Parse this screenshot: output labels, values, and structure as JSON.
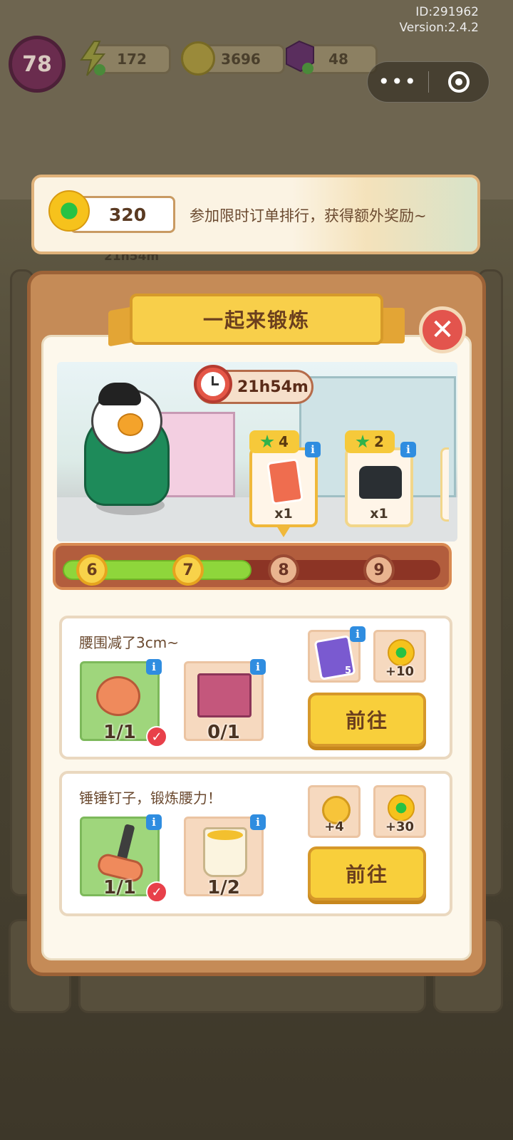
{
  "system": {
    "id": "ID:291962",
    "version": "Version:2.4.2"
  },
  "hud": {
    "level": "78",
    "energy": "172",
    "coins": "3696",
    "gems": "48",
    "energy_icon": "lightning-icon",
    "coin_icon": "coin-icon",
    "gem_icon": "gem-icon"
  },
  "miniprogram_capsule": {
    "menu_icon": "more-dots-icon",
    "close_icon": "target-close-icon",
    "menu_text": "•••"
  },
  "banner": {
    "score": "320",
    "text": "参加限时订单排行，获得额外奖励~",
    "icon": "flower-gem-icon"
  },
  "background": {
    "timer_text": "21h54m"
  },
  "dialog": {
    "title": "一起来锻炼",
    "close_icon": "close-icon",
    "close_glyph": "✕",
    "timer": "21h54m",
    "rewards": [
      {
        "points": "4",
        "qty": "x1",
        "icon": "upgrade-card-icon"
      },
      {
        "points": "2",
        "qty": "x1",
        "icon": "black-bag-icon"
      }
    ],
    "progress": {
      "levels": [
        "6",
        "7",
        "8",
        "9"
      ],
      "reached": 2,
      "fill_fraction": 0.5
    },
    "tasks": [
      {
        "title": "腰围减了3cm~",
        "items": [
          {
            "icon": "stopwatch-icon",
            "count": "1/1",
            "done": true
          },
          {
            "icon": "brick-pallet-icon",
            "count": "0/1",
            "done": false
          }
        ],
        "rewards": [
          {
            "icon": "photo-cards-icon",
            "value": "",
            "badge": "5"
          },
          {
            "icon": "flower-gem-icon",
            "value": "+10"
          }
        ],
        "button": "前往"
      },
      {
        "title": "锤锤钉子，锻炼腰力！",
        "items": [
          {
            "icon": "hammer-icon",
            "count": "1/1",
            "done": true
          },
          {
            "icon": "paint-bucket-icon",
            "count": "1/2",
            "done": false
          }
        ],
        "rewards": [
          {
            "icon": "coin-icon",
            "value": "+4"
          },
          {
            "icon": "flower-gem-icon",
            "value": "+30"
          }
        ],
        "button": "前往"
      }
    ]
  },
  "info_glyph": "i",
  "check_glyph": "✓",
  "colors": {
    "accent": "#f8cf3b",
    "done_green": "#9fd67c",
    "close_red": "#e3544d",
    "progress_green": "#8ed63b"
  }
}
